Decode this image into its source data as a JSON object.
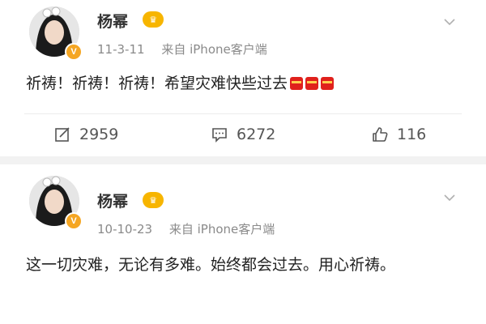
{
  "posts": [
    {
      "author": "杨幂",
      "vip_badge": "V",
      "crown_label": "♛",
      "date": "11-3-11",
      "source": "来自 iPhone客户端",
      "text": "祈祷！祈祷！祈祷！希望灾难快些过去",
      "emoji_count": 3,
      "reposts": "2959",
      "comments": "6272",
      "likes": "116"
    },
    {
      "author": "杨幂",
      "vip_badge": "V",
      "crown_label": "♛",
      "date": "10-10-23",
      "source": "来自 iPhone客户端",
      "text": "这一切灾难，无论有多难。始终都会过去。用心祈祷。"
    }
  ],
  "icons": {
    "repost": "repost-icon",
    "comment": "comment-icon",
    "like": "thumbs-up-icon",
    "menu": "chevron-down-icon"
  },
  "colors": {
    "vip": "#f5a623",
    "muted_text": "#8a8a8a",
    "gift": "#e0211c"
  }
}
